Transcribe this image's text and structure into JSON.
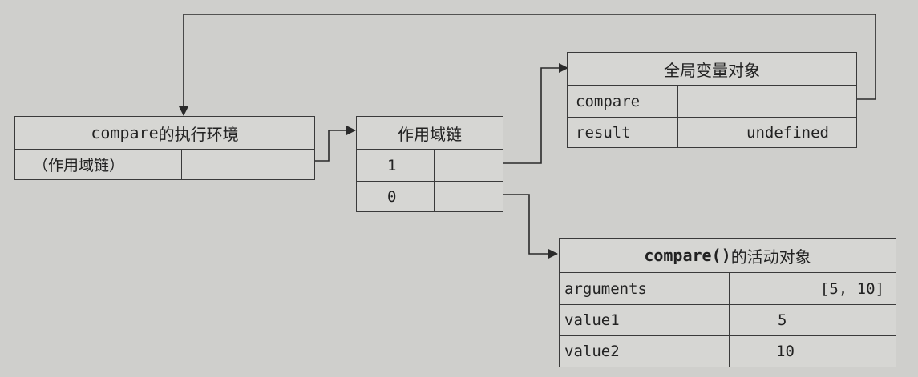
{
  "exec_context": {
    "title_code": "compare",
    "title_text": " 的执行环境",
    "row_label": "（作用域链）"
  },
  "scope_chain": {
    "title": "作用域链",
    "rows": [
      "1",
      "0"
    ]
  },
  "global_object": {
    "title": "全局变量对象",
    "rows": [
      {
        "name": "compare",
        "value": ""
      },
      {
        "name": "result",
        "value": "undefined"
      }
    ]
  },
  "activation_object": {
    "title_code": "compare()",
    "title_text": " 的活动对象",
    "rows": [
      {
        "name": "arguments",
        "value": "[5, 10]"
      },
      {
        "name": "value1",
        "value": "5"
      },
      {
        "name": "value2",
        "value": "10"
      }
    ]
  }
}
